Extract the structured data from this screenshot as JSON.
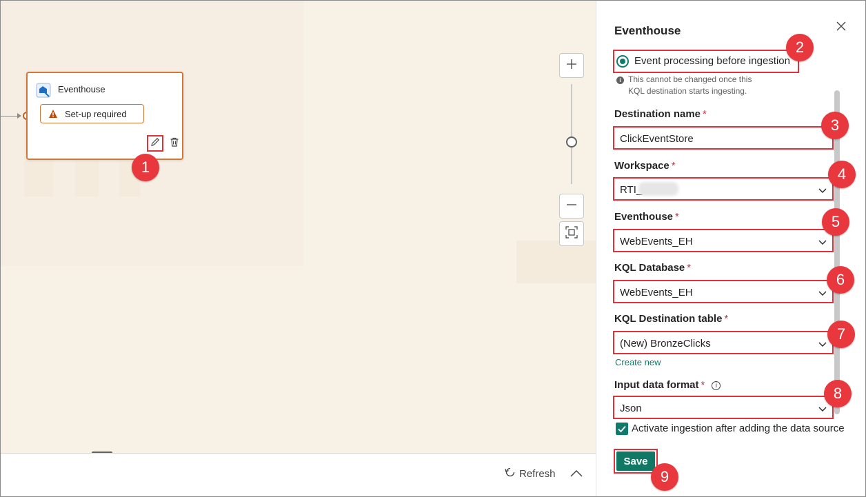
{
  "canvas": {
    "node": {
      "title": "Eventhouse",
      "warning": "Set-up required",
      "icon": "eventhouse-icon"
    }
  },
  "bottom_bar": {
    "refresh_label": "Refresh"
  },
  "panel": {
    "title": "Eventhouse",
    "mode_option": "Event processing before ingestion",
    "mode_note": "This cannot be changed once this KQL destination starts ingesting.",
    "fields": {
      "destination_name": {
        "label": "Destination name",
        "value": "ClickEventStore"
      },
      "workspace": {
        "label": "Workspace",
        "value": "RTI_1"
      },
      "eventhouse": {
        "label": "Eventhouse",
        "value": "WebEvents_EH"
      },
      "kql_database": {
        "label": "KQL Database",
        "value": "WebEvents_EH"
      },
      "kql_table": {
        "label": "KQL Destination table",
        "value": "(New) BronzeClicks"
      },
      "input_format": {
        "label": "Input data format",
        "value": "Json"
      }
    },
    "required_mark": "*",
    "create_new": "Create new",
    "activate_label": "Activate ingestion after adding the data source",
    "save_label": "Save"
  },
  "callouts": [
    "1",
    "2",
    "3",
    "4",
    "5",
    "6",
    "7",
    "8",
    "9"
  ],
  "colors": {
    "canvas_bg": "#f8f1e6",
    "node_border": "#d0773a",
    "accent_green": "#117865",
    "callout_red": "#e8373d"
  }
}
